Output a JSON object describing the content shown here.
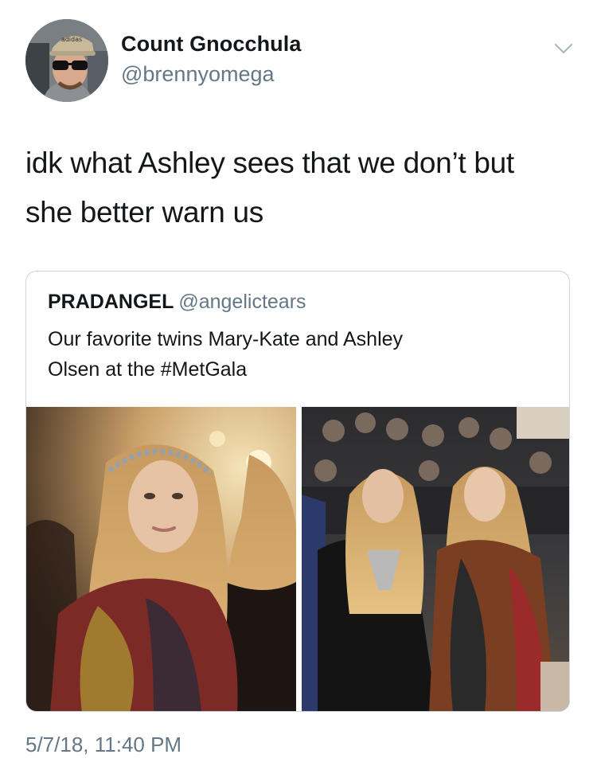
{
  "author": {
    "display_name": "Count Gnocchula",
    "handle": "@brennyomega",
    "avatar_cap_text": "adidas"
  },
  "tweet": {
    "text_lines": [
      "idk what Ashley sees that we don’t but",
      "she better warn us"
    ],
    "timestamp": "5/7/18, 11:40 PM"
  },
  "quoted_tweet": {
    "display_name": "PRADANGEL",
    "handle": "@angelictears",
    "text_lines": [
      "Our favorite twins Mary-Kate and Ashley",
      "Olsen at the #MetGala"
    ]
  },
  "icons": {
    "menu": "chevron-down-icon"
  },
  "colors": {
    "text_primary": "#14171a",
    "text_secondary": "#657786",
    "border": "#ccd6dd",
    "chevron": "#aab8c2"
  }
}
